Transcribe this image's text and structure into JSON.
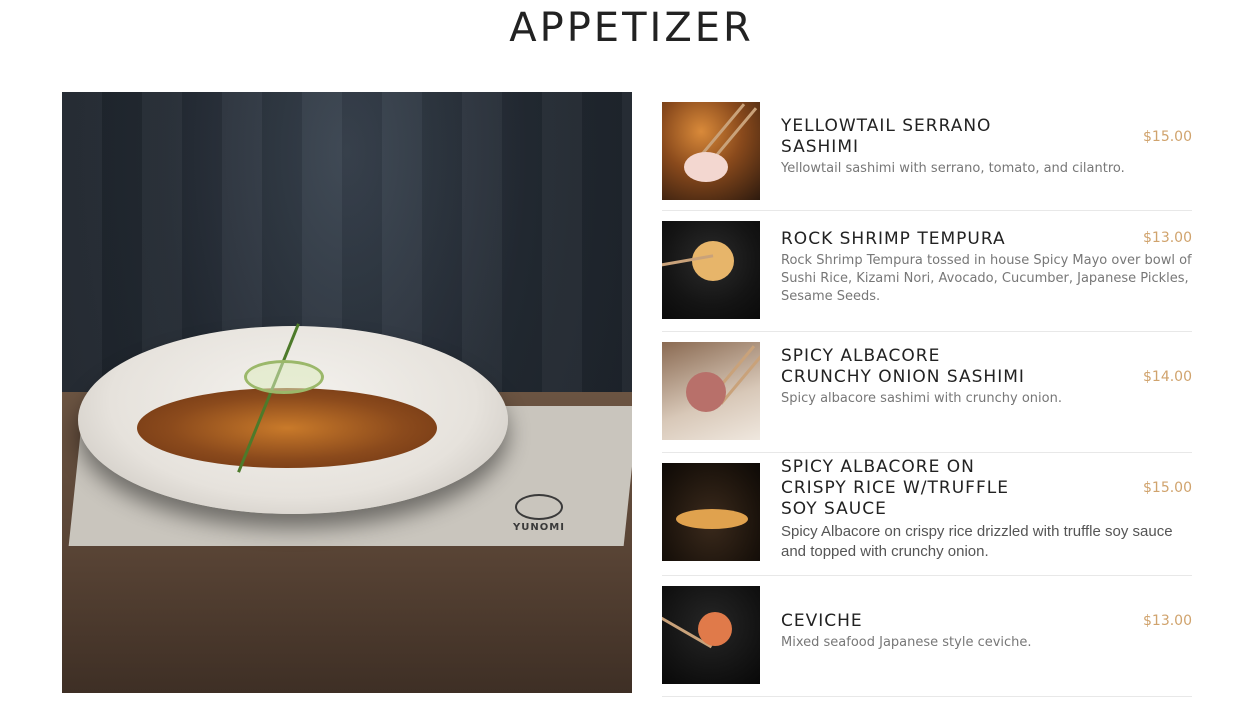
{
  "section_title": "APPETIZER",
  "colors": {
    "price": "#d0a36d",
    "title": "#222222",
    "description": "#777777",
    "divider": "#e8e8e8"
  },
  "hero_image": {
    "logo_text": "YUNOMI"
  },
  "menu": {
    "items": [
      {
        "name": "YELLOWTAIL SERRANO SASHIMI",
        "description": "Yellowtail sashimi with serrano, tomato, and cilantro.",
        "price": "$15.00"
      },
      {
        "name": "ROCK SHRIMP TEMPURA",
        "description": "Rock Shrimp Tempura tossed in house Spicy Mayo over bowl of Sushi Rice, Kizami Nori, Avocado, Cucumber, Japanese Pickles, Sesame Seeds.",
        "price": "$13.00"
      },
      {
        "name": "SPICY ALBACORE CRUNCHY ONION SASHIMI",
        "description": "Spicy albacore sashimi with crunchy onion.",
        "price": "$14.00"
      },
      {
        "name": "SPICY ALBACORE ON CRISPY RICE W/TRUFFLE SOY SAUCE",
        "description": "Spicy Albacore on crispy rice drizzled with truffle soy sauce and topped with crunchy onion.",
        "price": "$15.00"
      },
      {
        "name": "CEVICHE",
        "description": "Mixed seafood Japanese style ceviche.",
        "price": "$13.00"
      }
    ]
  }
}
